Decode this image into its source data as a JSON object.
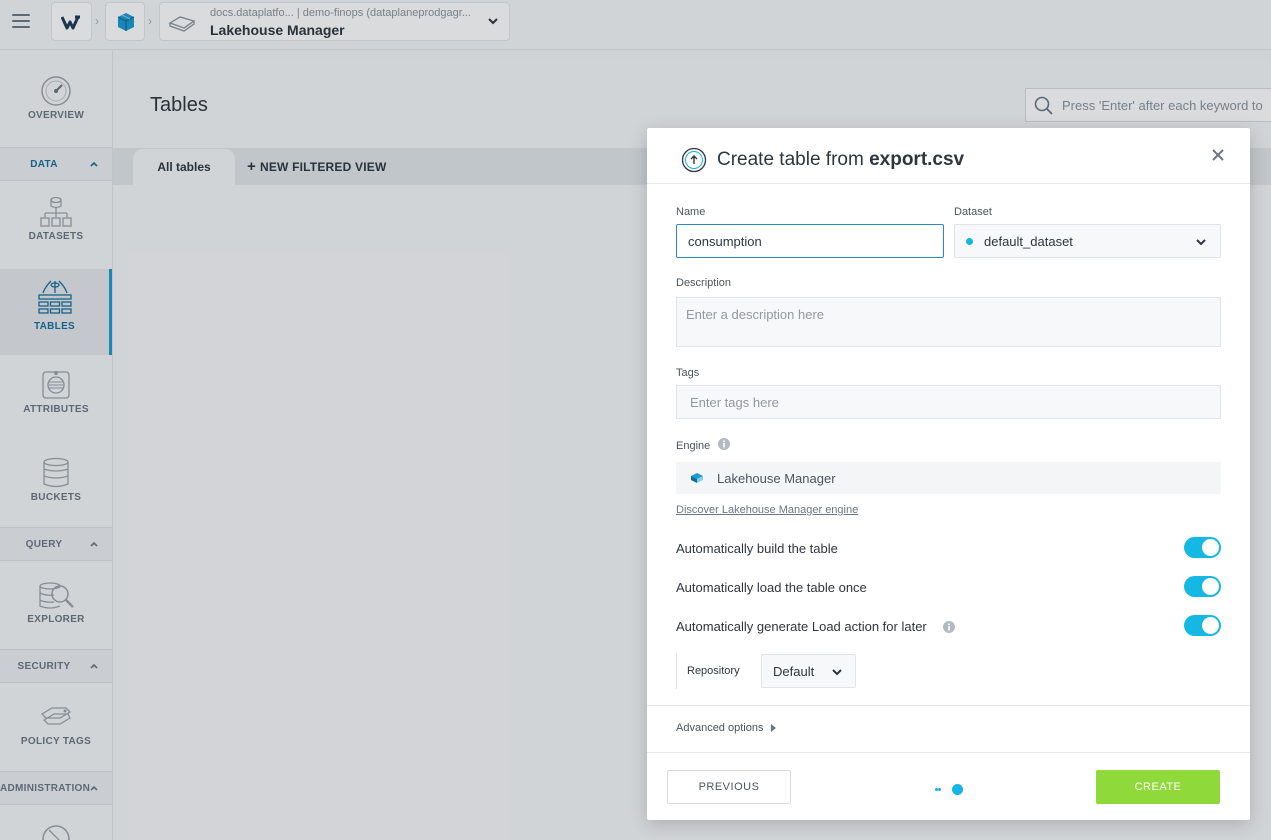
{
  "app": {
    "breadcrumb_sub": "docs.dataplatfo... | demo-finops (dataplaneprodgagr...",
    "breadcrumb_title": "Lakehouse Manager"
  },
  "nav": {
    "overview": "OVERVIEW",
    "sections": {
      "data": "DATA",
      "query": "QUERY",
      "security": "SECURITY",
      "administration": "ADMINISTRATION"
    },
    "items": {
      "datasets": "DATASETS",
      "tables": "TABLES",
      "attributes": "ATTRIBUTES",
      "buckets": "BUCKETS",
      "explorer": "EXPLORER",
      "policy_tags": "POLICY TAGS"
    },
    "active": "tables"
  },
  "main": {
    "title": "Tables",
    "search_placeholder": "Press 'Enter' after each keyword to",
    "tabs": {
      "all": "All tables",
      "new_view": "NEW FILTERED VIEW"
    }
  },
  "modal": {
    "title_prefix": "Create table from",
    "title_file": "export.csv",
    "name_label": "Name",
    "name_value": "consumption",
    "dataset_label": "Dataset",
    "dataset_value": "default_dataset",
    "description_label": "Description",
    "description_placeholder": "Enter a description here",
    "tags_label": "Tags",
    "tags_placeholder": "Enter tags here",
    "engine_label": "Engine",
    "engine_value": "Lakehouse Manager",
    "discover_link": "Discover Lakehouse Manager engine",
    "toggles": [
      {
        "label": "Automatically build the table",
        "on": true
      },
      {
        "label": "Automatically load the table once",
        "on": true
      },
      {
        "label": "Automatically generate Load action for later",
        "on": true
      }
    ],
    "repository_label": "Repository",
    "repository_value": "Default",
    "advanced_label": "Advanced options",
    "previous_label": "PREVIOUS",
    "create_label": "CREATE"
  },
  "colors": {
    "accent": "#14b8e2",
    "create": "#8fd93a",
    "active_nav": "#1a9bd1"
  }
}
